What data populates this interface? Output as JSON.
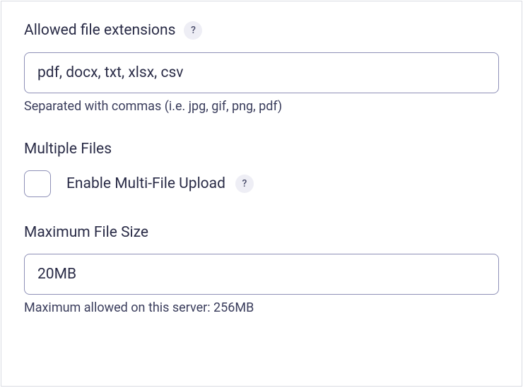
{
  "extensions": {
    "label": "Allowed file extensions",
    "value": "pdf, docx, txt, xlsx, csv",
    "helper": "Separated with commas (i.e. jpg, gif, png, pdf)",
    "help_badge": "?"
  },
  "multiple": {
    "label": "Multiple Files",
    "checkbox_label": "Enable Multi-File Upload",
    "help_badge": "?",
    "checked": false
  },
  "maxsize": {
    "label": "Maximum File Size",
    "value": "20MB",
    "helper": "Maximum allowed on this server: 256MB"
  }
}
